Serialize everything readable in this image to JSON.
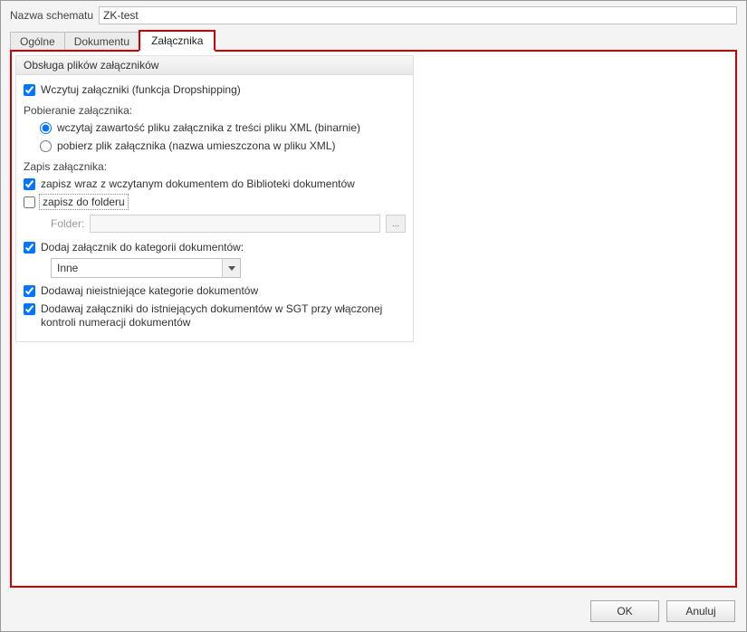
{
  "schema": {
    "label": "Nazwa schematu",
    "value": "ZK-test"
  },
  "tabs": [
    {
      "label": "Ogólne"
    },
    {
      "label": "Dokumentu"
    },
    {
      "label": "Załącznika"
    }
  ],
  "panel": {
    "title": "Obsługa plików załączników",
    "load_attachments": "Wczytuj załączniki (funkcja Dropshipping)",
    "download_heading": "Pobieranie załącznika:",
    "radio_binary": "wczytaj zawartość pliku załącznika z treści pliku XML (binarnie)",
    "radio_fetch": "pobierz plik załącznika (nazwa umieszczona w pliku XML)",
    "save_heading": "Zapis załącznika:",
    "save_with_doc": "zapisz wraz z wczytanym dokumentem do Biblioteki dokumentów",
    "save_to_folder": "zapisz do folderu",
    "folder_label": "Folder:",
    "folder_value": "",
    "folder_browse": "...",
    "add_category": "Dodaj załącznik do kategorii dokumentów:",
    "category_value": "Inne",
    "add_missing_categories": "Dodawaj nieistniejące kategorie dokumentów",
    "add_to_existing": "Dodawaj załączniki do istniejących dokumentów w SGT przy włączonej kontroli numeracji dokumentów"
  },
  "buttons": {
    "ok": "OK",
    "cancel": "Anuluj"
  }
}
